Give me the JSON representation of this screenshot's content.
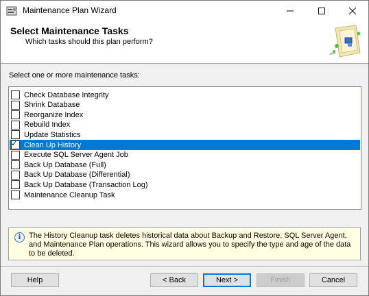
{
  "window": {
    "title": "Maintenance Plan Wizard"
  },
  "header": {
    "title": "Select Maintenance Tasks",
    "subtitle": "Which tasks should this plan perform?"
  },
  "prompt": "Select one or more maintenance tasks:",
  "tasks": [
    {
      "label": "Check Database Integrity",
      "checked": false,
      "selected": false
    },
    {
      "label": "Shrink Database",
      "checked": false,
      "selected": false
    },
    {
      "label": "Reorganize Index",
      "checked": false,
      "selected": false
    },
    {
      "label": "Rebuild Index",
      "checked": false,
      "selected": false
    },
    {
      "label": "Update Statistics",
      "checked": false,
      "selected": false
    },
    {
      "label": "Clean Up History",
      "checked": true,
      "selected": true
    },
    {
      "label": "Execute SQL Server Agent Job",
      "checked": false,
      "selected": false
    },
    {
      "label": "Back Up Database (Full)",
      "checked": false,
      "selected": false
    },
    {
      "label": "Back Up Database (Differential)",
      "checked": false,
      "selected": false
    },
    {
      "label": "Back Up Database (Transaction Log)",
      "checked": false,
      "selected": false
    },
    {
      "label": "Maintenance Cleanup Task",
      "checked": false,
      "selected": false
    }
  ],
  "info": {
    "text": "The History Cleanup task deletes historical data about Backup and Restore, SQL Server Agent, and Maintenance Plan operations.  This wizard allows you to specify the type and age of the data to be deleted."
  },
  "buttons": {
    "help": "Help",
    "back": "< Back",
    "next": "Next >",
    "finish": "Finish",
    "cancel": "Cancel"
  },
  "colors": {
    "selection": "#0078d7",
    "info_bg": "#ffffe1"
  }
}
